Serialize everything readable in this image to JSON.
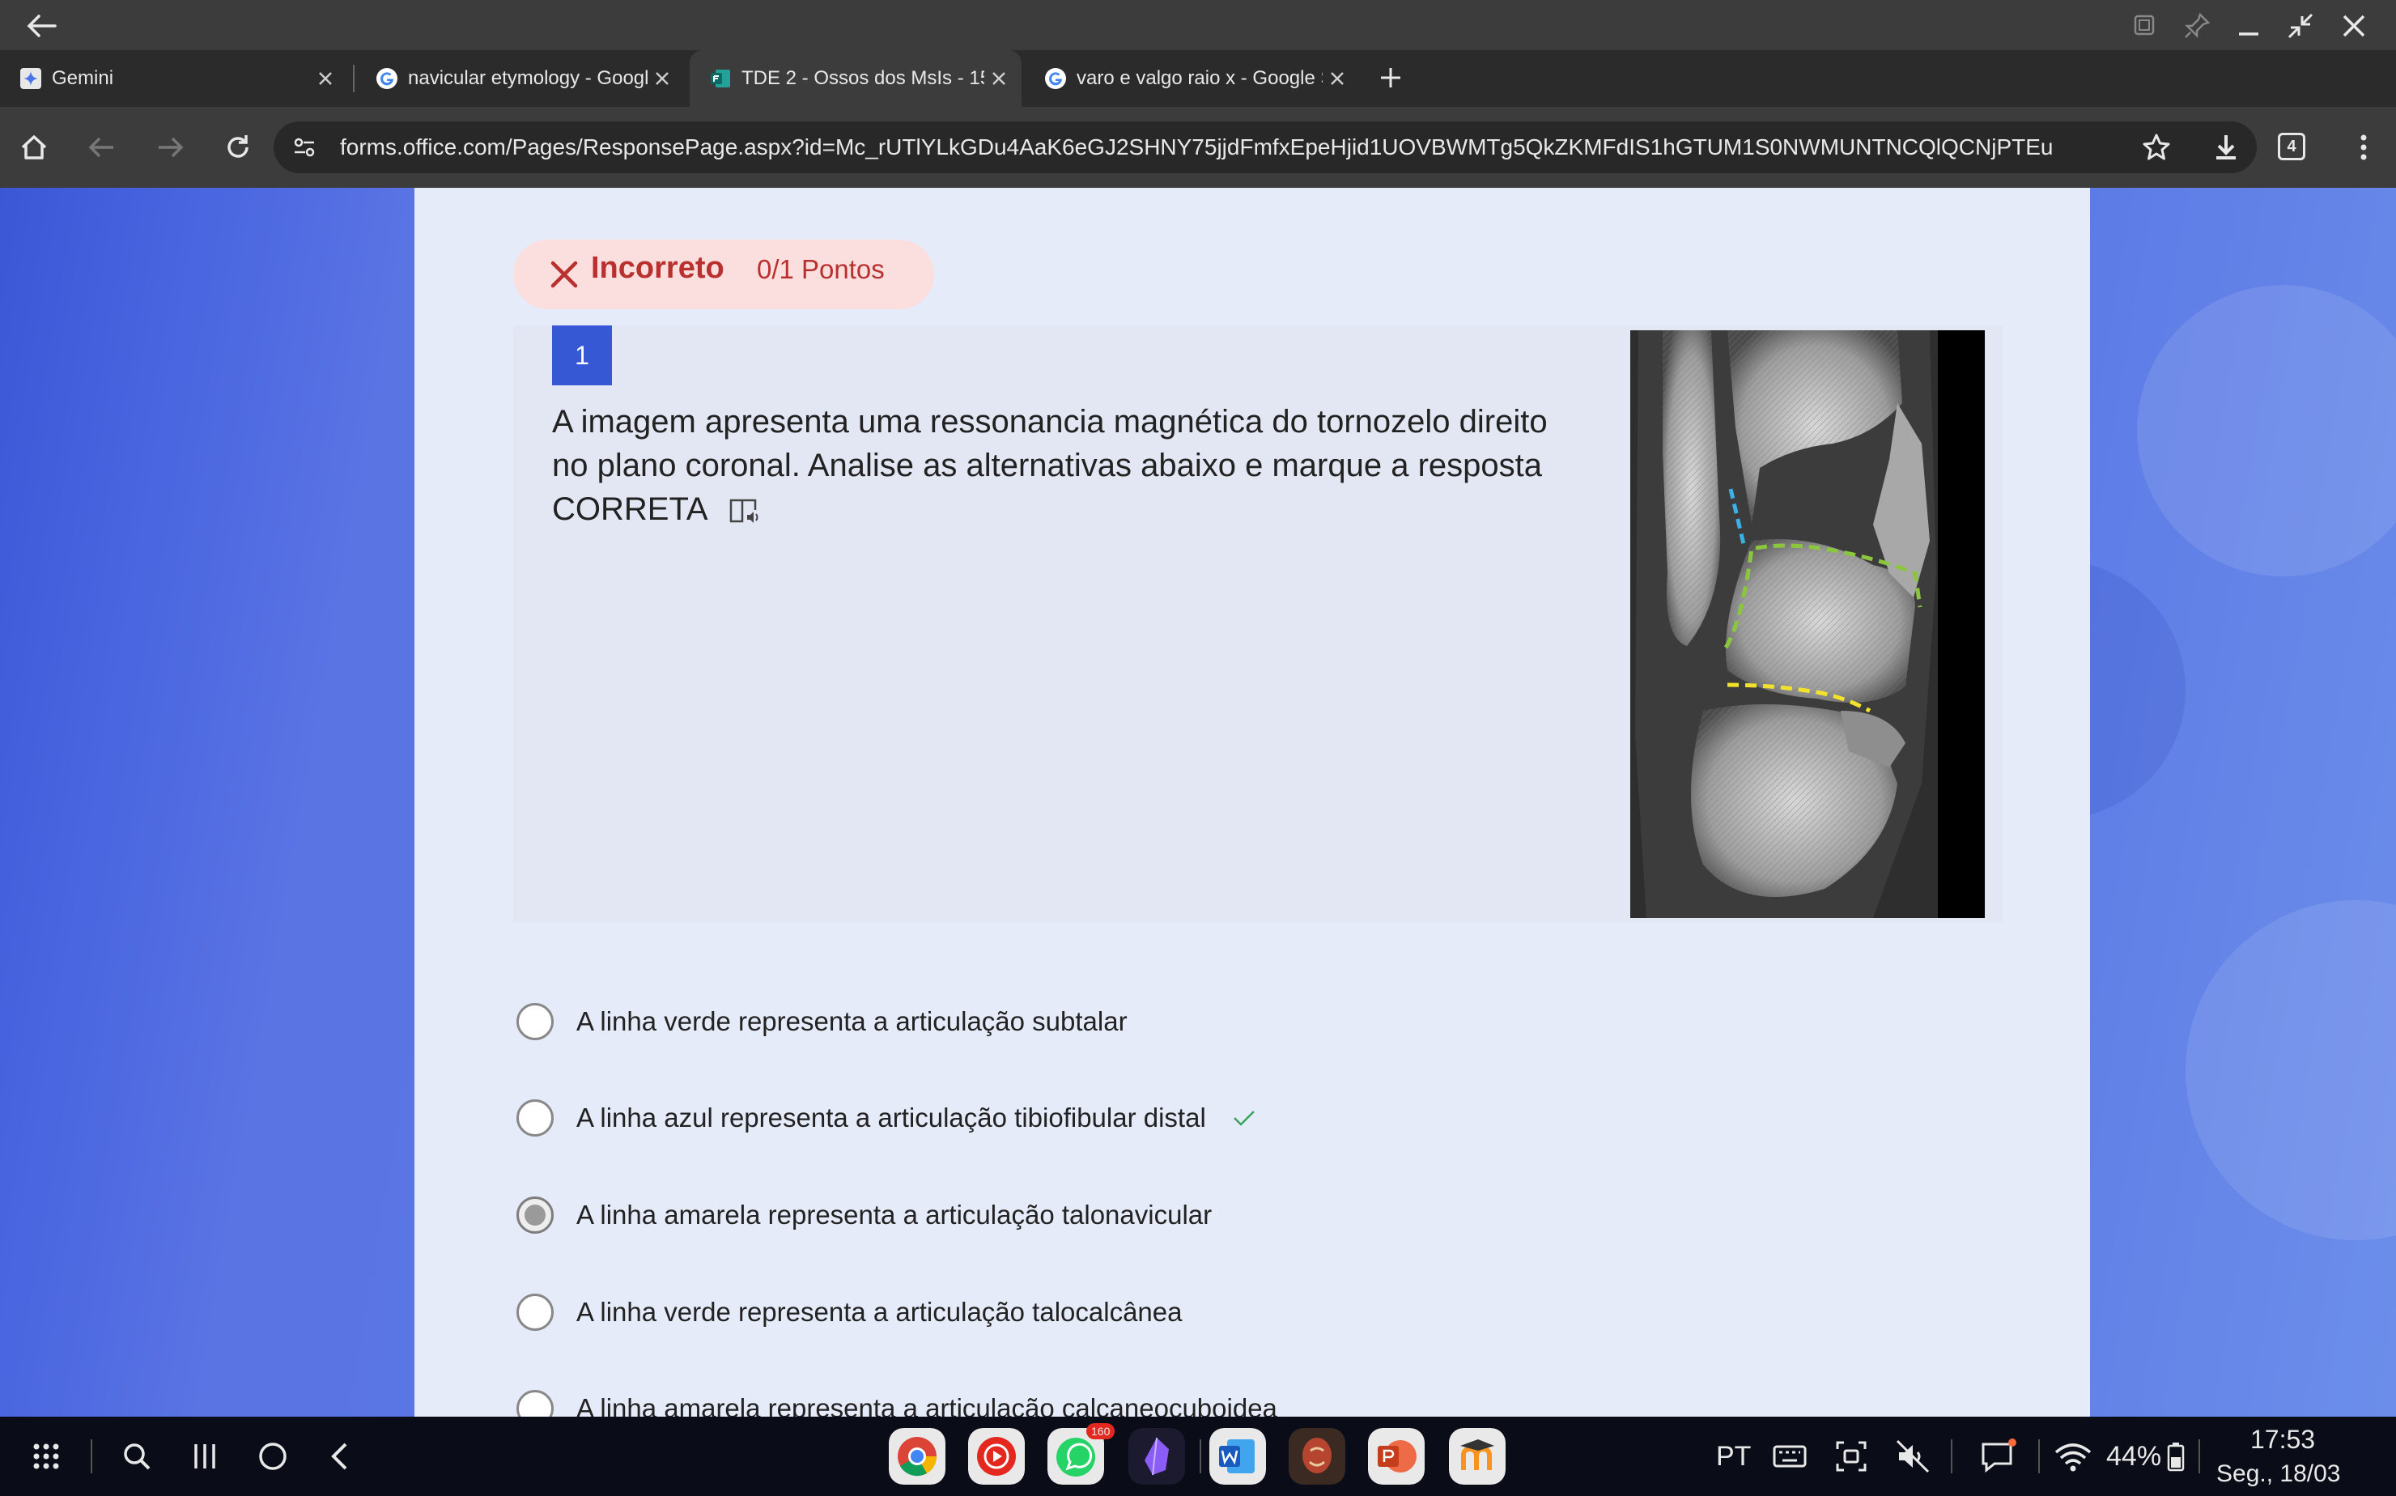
{
  "tabs": [
    {
      "title": "Gemini",
      "active": false
    },
    {
      "title": "navicular etymology - Google",
      "active": false
    },
    {
      "title": "TDE 2 - Ossos dos MsIs - 15/",
      "active": true
    },
    {
      "title": "varo e valgo raio x - Google S",
      "active": false
    }
  ],
  "address_bar": {
    "url": "forms.office.com/Pages/ResponsePage.aspx?id=Mc_rUTlYLkGDu4AaK6eGJ2SHNY75jjdFmfxEpeHjid1UOVBWMTg5QkZKMFdIS1hGTUM1S0NWMUNTNCQlQCNjPTEu",
    "tab_count": "4"
  },
  "result": {
    "status": "Incorreto",
    "points": "0/1 Pontos"
  },
  "question": {
    "number": "1",
    "text": "A imagem apresenta uma ressonancia magnética do tornozelo direito no plano coronal. Analise as alternativas abaixo e marque a resposta CORRETA"
  },
  "options": [
    {
      "label": "A linha verde representa a articulação subtalar",
      "selected": false,
      "correct": false
    },
    {
      "label": "A linha azul representa a articulação tibiofibular distal",
      "selected": false,
      "correct": true
    },
    {
      "label": "A linha amarela representa a articulação talonavicular",
      "selected": true,
      "correct": false
    },
    {
      "label": "A linha verde representa a articulação talocalcânea",
      "selected": false,
      "correct": false
    },
    {
      "label": "A linha amarela representa a articulação calcaneocuboidea",
      "selected": false,
      "correct": false
    }
  ],
  "colors": {
    "incorrect_red": "#b8312f",
    "incorrect_bg": "#fbdede",
    "question_badge": "#3758d4",
    "correct_check": "#3aa35a",
    "mri_line_blue": "#3ab0e6",
    "mri_line_green": "#8cc63f",
    "mri_line_yellow": "#f2e22c"
  },
  "system": {
    "language": "PT",
    "battery": "44%",
    "time": "17:53",
    "date": "Seg., 18/03",
    "whatsapp_badge": "160"
  }
}
